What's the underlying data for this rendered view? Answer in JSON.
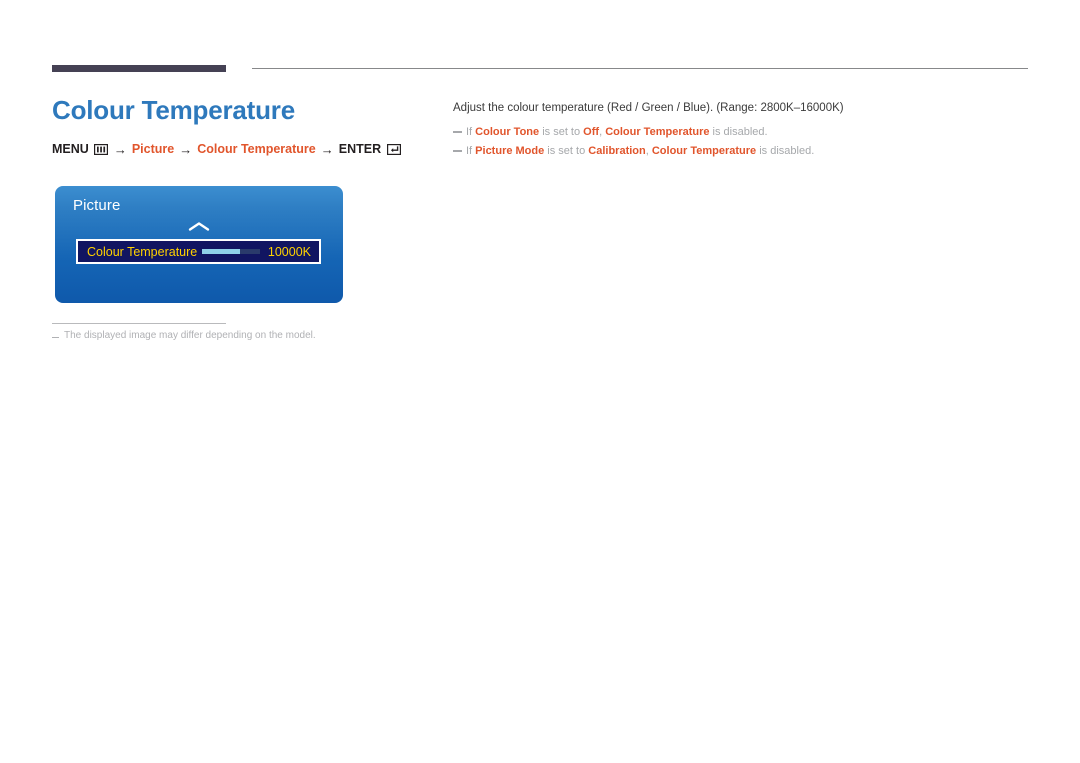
{
  "header": {
    "title": "Colour Temperature",
    "title_color": "#2e79bc",
    "accent_color": "#e1552c"
  },
  "breadcrumb": {
    "menu_label": "MENU",
    "menu_icon": "menu-grid-icon",
    "arrow": "→",
    "items": [
      {
        "label": "Picture",
        "accent": true
      },
      {
        "label": "Colour Temperature",
        "accent": true
      }
    ],
    "enter_label": "ENTER",
    "enter_icon": "enter-key-icon"
  },
  "osd": {
    "title": "Picture",
    "scroll_up_icon": "chevron-up-icon",
    "scroll_down_icon": "chevron-down-icon",
    "row": {
      "label": "Colour Temperature",
      "value": "10000K",
      "slider_fill_percent": 66,
      "label_color": "#ffd200",
      "background_color": "#111561"
    }
  },
  "image_note": {
    "text": "The displayed image may differ depending on the model."
  },
  "description": {
    "text": "Adjust the colour temperature (Red / Green / Blue). (Range: 2800K–16000K)"
  },
  "notes": [
    {
      "parts": [
        {
          "text": "If ",
          "style": "gray"
        },
        {
          "text": "Colour Tone",
          "style": "bold"
        },
        {
          "text": " is set to ",
          "style": "gray"
        },
        {
          "text": "Off",
          "style": "bold"
        },
        {
          "text": ", ",
          "style": "gray"
        },
        {
          "text": "Colour Temperature",
          "style": "bold"
        },
        {
          "text": " is disabled.",
          "style": "gray"
        }
      ]
    },
    {
      "parts": [
        {
          "text": "If ",
          "style": "gray"
        },
        {
          "text": "Picture Mode",
          "style": "bold"
        },
        {
          "text": " is set to ",
          "style": "gray"
        },
        {
          "text": "Calibration",
          "style": "bold"
        },
        {
          "text": ", ",
          "style": "gray"
        },
        {
          "text": "Colour Temperature",
          "style": "bold"
        },
        {
          "text": " is disabled.",
          "style": "gray"
        }
      ]
    }
  ]
}
